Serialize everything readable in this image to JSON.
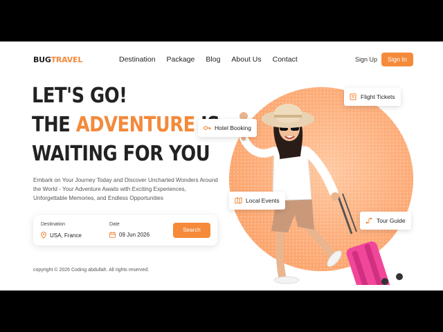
{
  "header": {
    "logo_part1": "BUG",
    "logo_part2": "TRAVEL",
    "nav": [
      "Destination",
      "Package",
      "Blog",
      "About Us",
      "Contact"
    ],
    "signup_label": "Sign Up",
    "signin_label": "Sign In"
  },
  "hero": {
    "line1": "LET'S GO!",
    "line2_pre": "THE ",
    "line2_accent": "ADVENTURE",
    "line2_post": " IS",
    "line3": "WAITING FOR YOU",
    "description": "Embark on Your Journey Today and Discover Uncharted Wonders Around the World - Your Adventure Awaits with Exciting Experiences, Unforgettable Memories, and Endless Opportunities"
  },
  "search": {
    "destination_label": "Destination",
    "destination_value": "USA, France",
    "date_label": "Date",
    "date_value": "09 Jun 2026",
    "button_label": "Search"
  },
  "tags": {
    "hotel": "Hotel Booking",
    "flight": "Flight Tickets",
    "events": "Local Events",
    "guide": "Tour Guide"
  },
  "icons": {
    "hotel": "key-icon",
    "flight": "ticket-icon",
    "events": "map-icon",
    "guide": "route-icon",
    "destination": "location-pin-icon",
    "date": "calendar-icon"
  },
  "colors": {
    "accent": "#f58a3a",
    "text": "#222222"
  },
  "footer": {
    "copyright": "copyright © 2026 Coding abdullah. All rights reserved."
  }
}
